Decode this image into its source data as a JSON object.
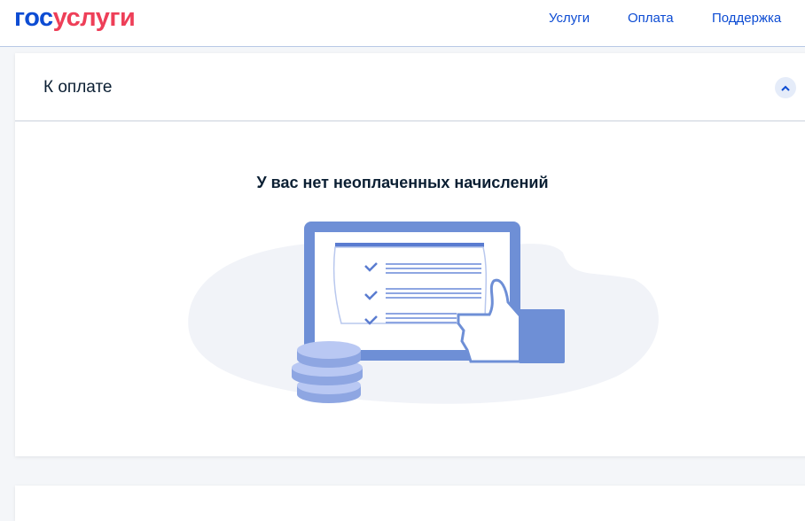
{
  "header": {
    "logo_part1": "гос",
    "logo_part2": "услуги",
    "nav": [
      "Услуги",
      "Оплата",
      "Поддержка"
    ]
  },
  "payment_card": {
    "title": "К оплате",
    "empty_message": "У вас нет неоплаченных начислений"
  },
  "colors": {
    "brand_blue": "#0d4cd3",
    "brand_red": "#ee3f58",
    "illustration": "#6e8fd6"
  }
}
